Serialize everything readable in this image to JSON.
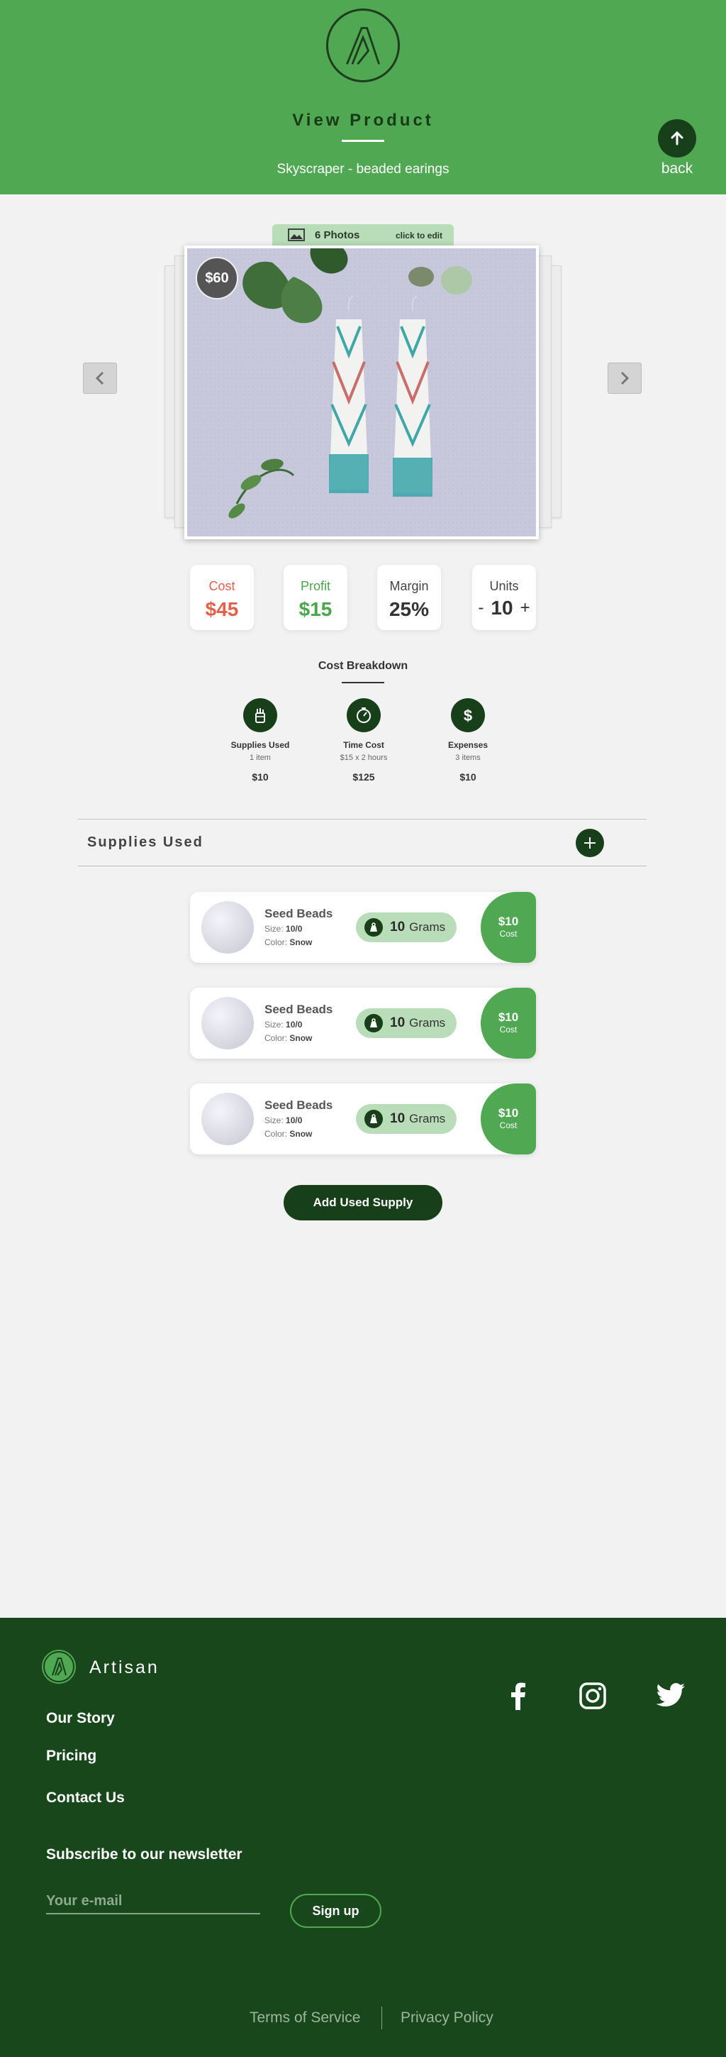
{
  "header": {
    "title": "View Product",
    "subtitle": "Skyscraper - beaded earings",
    "back_label": "back",
    "logo_icon": "artisan-a-logo"
  },
  "gallery": {
    "photo_count": "6 Photos",
    "edit_hint": "click to edit",
    "price": "$60",
    "prev_icon": "chevron-left-icon",
    "next_icon": "chevron-right-icon"
  },
  "stats": {
    "cost": {
      "label": "Cost",
      "value": "$45",
      "color": "#e4604a"
    },
    "profit": {
      "label": "Profit",
      "value": "$15",
      "color": "#4aa64c"
    },
    "margin": {
      "label": "Margin",
      "value": "25%"
    },
    "units": {
      "label": "Units",
      "minus": "-",
      "value": "10",
      "plus": "+"
    }
  },
  "breakdown": {
    "title": "Cost Breakdown",
    "items": [
      {
        "name": "Supplies Used",
        "sub": "1 item",
        "amount": "$10",
        "icon": "supplies-jar-icon"
      },
      {
        "name": "Time Cost",
        "sub": "$15 x 2 hours",
        "amount": "$125",
        "icon": "stopwatch-icon"
      },
      {
        "name": "Expenses",
        "sub": "3 items",
        "amount": "$10",
        "icon": "dollar-icon"
      }
    ]
  },
  "supplies": {
    "title": "Supplies Used",
    "size_label": "Size:",
    "color_label": "Color:",
    "cost_label": "Cost",
    "items": [
      {
        "name": "Seed Beads",
        "size": "10/0",
        "color": "Snow",
        "qty": "10",
        "unit": "Grams",
        "cost": "$10"
      },
      {
        "name": "Seed Beads",
        "size": "10/0",
        "color": "Snow",
        "qty": "10",
        "unit": "Grams",
        "cost": "$10"
      },
      {
        "name": "Seed Beads",
        "size": "10/0",
        "color": "Snow",
        "qty": "10",
        "unit": "Grams",
        "cost": "$10"
      }
    ],
    "add_button": "Add Used Supply"
  },
  "footer": {
    "brand": "Artisan",
    "links": [
      "Our Story",
      "Pricing",
      "Contact Us"
    ],
    "newsletter_title": "Subscribe to our newsletter",
    "email_placeholder": "Your e-mail",
    "signup_label": "Sign up",
    "social": [
      "facebook-icon",
      "instagram-icon",
      "twitter-icon"
    ],
    "terms": "Terms of Service",
    "privacy": "Privacy Policy"
  },
  "colors": {
    "brand_green": "#50a852",
    "dark_green": "#17401a",
    "light_green": "#b9dcb9",
    "background": "#f2f2f2",
    "footer_bg": "#17471b"
  }
}
